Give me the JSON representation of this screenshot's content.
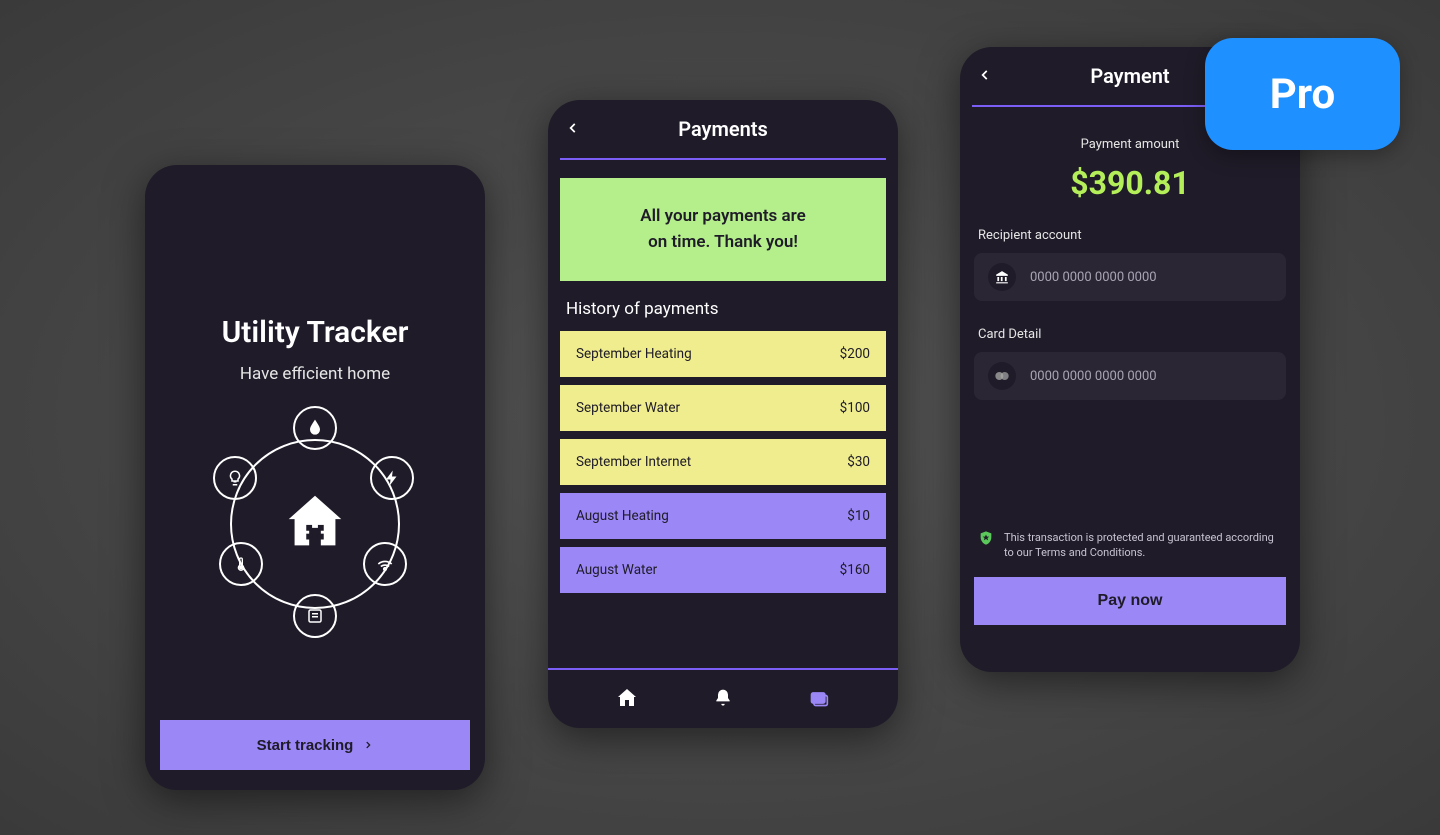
{
  "onboard": {
    "title": "Utility Tracker",
    "subtitle": "Have efficient home",
    "start_label": "Start tracking"
  },
  "payments": {
    "title": "Payments",
    "banner_line1": "All your payments are",
    "banner_line2": "on time. Thank you!",
    "history_label": "History of payments",
    "history": [
      {
        "label": "September Heating",
        "amount": "$200",
        "color": "yellow"
      },
      {
        "label": "September Water",
        "amount": "$100",
        "color": "yellow"
      },
      {
        "label": "September Internet",
        "amount": "$30",
        "color": "yellow"
      },
      {
        "label": "August Heating",
        "amount": "$10",
        "color": "purple"
      },
      {
        "label": "August Water",
        "amount": "$160",
        "color": "purple"
      }
    ]
  },
  "payment": {
    "title": "Payment",
    "amount_label": "Payment amount",
    "amount_value": "$390.81",
    "recipient_label": "Recipient account",
    "recipient_placeholder": "0000 0000 0000 0000",
    "card_label": "Card Detail",
    "card_placeholder": "0000 0000 0000 0000",
    "protection_note": "This transaction is protected and guaranteed according to our Terms and Conditions.",
    "pay_button": "Pay now"
  },
  "badge": {
    "label": "Pro"
  },
  "colors": {
    "accent_purple": "#9b87f5",
    "accent_green": "#b4ef5a"
  }
}
